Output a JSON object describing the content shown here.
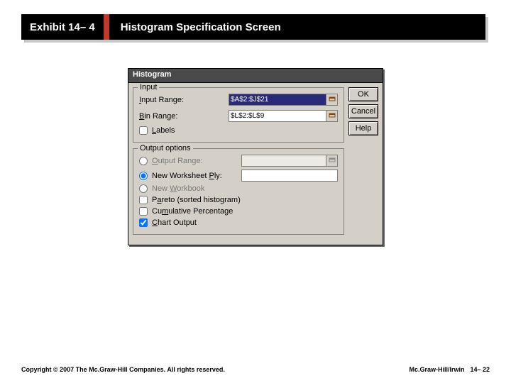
{
  "slide": {
    "exhibit_tag": "Exhibit 14– 4",
    "title": "Histogram Specification Screen"
  },
  "dialog": {
    "title": "Histogram",
    "input_group": "Input",
    "input_range_label": "Input Range:",
    "input_range_value": "$A$2:$J$21",
    "bin_range_label": "Bin Range:",
    "bin_range_value": "$L$2:$L$9",
    "labels_checkbox": "Labels",
    "output_group": "Output options",
    "output_range_label": "Output Range:",
    "output_range_value": "",
    "new_ws_label": "New Worksheet Ply:",
    "new_ws_value": "",
    "new_wb_label": "New Workbook",
    "pareto_label": "Pareto (sorted histogram)",
    "cumpct_label": "Cumulative Percentage",
    "chartout_label": "Chart Output",
    "buttons": {
      "ok": "OK",
      "cancel": "Cancel",
      "help": "Help"
    }
  },
  "footer": {
    "copyright": "Copyright © 2007 The Mc.Graw-Hill Companies. All rights reserved.",
    "publisher": "Mc.Graw-Hill/Irwin",
    "pagenum": "14– 22"
  }
}
